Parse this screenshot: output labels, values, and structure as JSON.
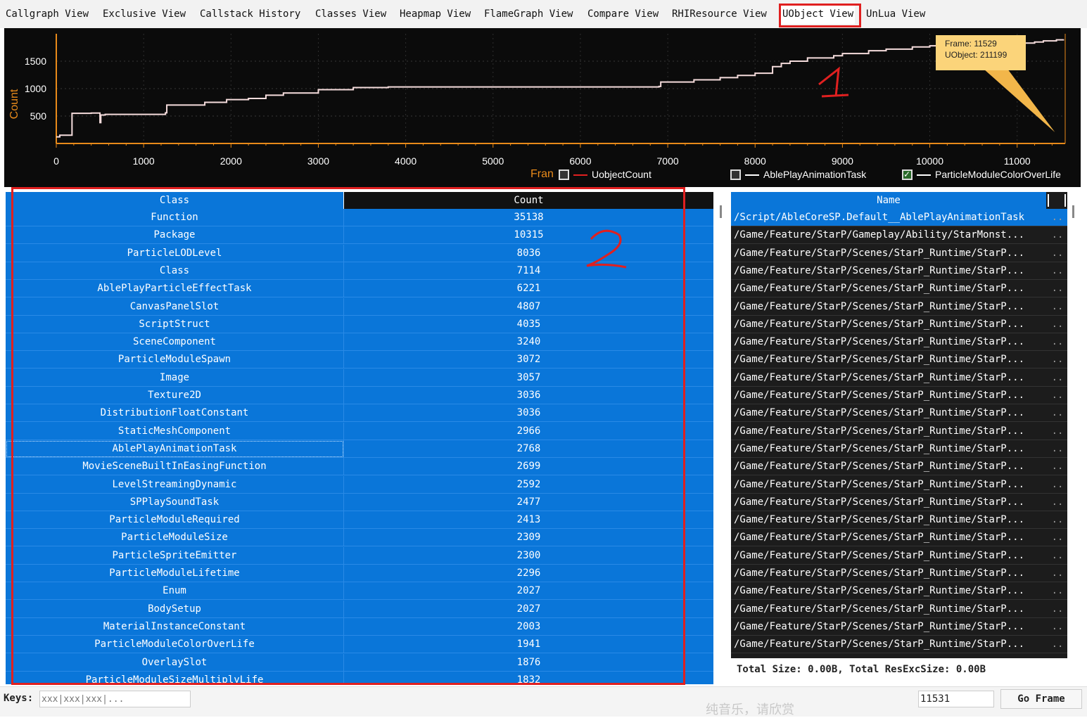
{
  "tabs": [
    {
      "label": "Callgraph View"
    },
    {
      "label": "Exclusive View"
    },
    {
      "label": "Callstack History"
    },
    {
      "label": "Classes View"
    },
    {
      "label": "Heapmap View"
    },
    {
      "label": "FlameGraph View"
    },
    {
      "label": "Compare View"
    },
    {
      "label": "RHIResource View"
    },
    {
      "label": "UObject View",
      "active": true
    },
    {
      "label": "UnLua View"
    }
  ],
  "annotations": {
    "one": "1",
    "two": "2"
  },
  "colors": {
    "selection_blue": "#0a76d9",
    "annotation_red": "#e02020",
    "chart_line": "#f5dcdc",
    "axis_orange": "#e88a1a",
    "tooltip_bg": "#fbd47a"
  },
  "chart_data": {
    "type": "line",
    "ylabel": "Count",
    "xlabel": "Fran",
    "xlim": [
      0,
      11550
    ],
    "ylim": [
      0,
      2000
    ],
    "yticks": [
      500,
      1000,
      1500
    ],
    "xticks": [
      0,
      1000,
      2000,
      3000,
      4000,
      5000,
      6000,
      7000,
      8000,
      9000,
      10000,
      11000
    ],
    "grid": true,
    "series": [
      {
        "name": "UobjectCount",
        "color": "#e02020",
        "checked": false,
        "x": [
          0,
          40,
          100,
          180,
          400,
          500,
          510,
          560,
          1250,
          1265,
          1700,
          1950,
          2200,
          2400,
          2600,
          3000,
          3400,
          3800,
          4500,
          5500,
          6500,
          6900,
          6920,
          7300,
          7600,
          7800,
          8000,
          8200,
          8300,
          8400,
          8600,
          8900,
          9000,
          9300,
          9500,
          9800,
          10000,
          10500,
          10800,
          11000,
          11200,
          11300,
          11450,
          11529
        ],
        "values": [
          120,
          150,
          150,
          550,
          555,
          380,
          520,
          530,
          560,
          700,
          750,
          800,
          820,
          880,
          920,
          980,
          1020,
          1030,
          1030,
          1030,
          1030,
          1040,
          1120,
          1160,
          1200,
          1240,
          1280,
          1400,
          1460,
          1500,
          1560,
          1600,
          1640,
          1690,
          1720,
          1760,
          1780,
          1790,
          1810,
          1830,
          1850,
          1870,
          1890,
          1900
        ]
      }
    ],
    "legend": [
      {
        "name": "UobjectCount",
        "checked": false,
        "color": "#e02020"
      },
      {
        "name": "AblePlayAnimationTask",
        "checked": false,
        "color": "#ffffff"
      },
      {
        "name": "ParticleModuleColorOverLife",
        "checked": true,
        "color": "#ffffff"
      }
    ],
    "tooltip": {
      "frame_text": "Frame: 11529",
      "uobject_text": "UObject: 211199"
    }
  },
  "class_table": {
    "headers": {
      "class": "Class",
      "count": "Count"
    },
    "rows": [
      {
        "class": "Function",
        "count": "35138"
      },
      {
        "class": "Package",
        "count": "10315"
      },
      {
        "class": "ParticleLODLevel",
        "count": "8036"
      },
      {
        "class": "Class",
        "count": "7114"
      },
      {
        "class": "AblePlayParticleEffectTask",
        "count": "6221"
      },
      {
        "class": "CanvasPanelSlot",
        "count": "4807"
      },
      {
        "class": "ScriptStruct",
        "count": "4035"
      },
      {
        "class": "SceneComponent",
        "count": "3240"
      },
      {
        "class": "ParticleModuleSpawn",
        "count": "3072"
      },
      {
        "class": "Image",
        "count": "3057"
      },
      {
        "class": "Texture2D",
        "count": "3036"
      },
      {
        "class": "DistributionFloatConstant",
        "count": "3036"
      },
      {
        "class": "StaticMeshComponent",
        "count": "2966"
      },
      {
        "class": "AblePlayAnimationTask",
        "count": "2768"
      },
      {
        "class": "MovieSceneBuiltInEasingFunction",
        "count": "2699"
      },
      {
        "class": "LevelStreamingDynamic",
        "count": "2592"
      },
      {
        "class": "SPPlaySoundTask",
        "count": "2477"
      },
      {
        "class": "ParticleModuleRequired",
        "count": "2413"
      },
      {
        "class": "ParticleModuleSize",
        "count": "2309"
      },
      {
        "class": "ParticleSpriteEmitter",
        "count": "2300"
      },
      {
        "class": "ParticleModuleLifetime",
        "count": "2296"
      },
      {
        "class": "Enum",
        "count": "2027"
      },
      {
        "class": "BodySetup",
        "count": "2027"
      },
      {
        "class": "MaterialInstanceConstant",
        "count": "2003"
      },
      {
        "class": "ParticleModuleColorOverLife",
        "count": "1941"
      },
      {
        "class": "OverlaySlot",
        "count": "1876"
      },
      {
        "class": "ParticleModuleSizeMultiplyLife",
        "count": "1832"
      }
    ]
  },
  "name_table": {
    "header": "Name",
    "rows": [
      "/Script/AbleCoreSP.Default__AblePlayAnimationTask",
      "/Game/Feature/StarP/Gameplay/Ability/StarMonst...",
      "/Game/Feature/StarP/Scenes/StarP_Runtime/StarP...",
      "/Game/Feature/StarP/Scenes/StarP_Runtime/StarP...",
      "/Game/Feature/StarP/Scenes/StarP_Runtime/StarP...",
      "/Game/Feature/StarP/Scenes/StarP_Runtime/StarP...",
      "/Game/Feature/StarP/Scenes/StarP_Runtime/StarP...",
      "/Game/Feature/StarP/Scenes/StarP_Runtime/StarP...",
      "/Game/Feature/StarP/Scenes/StarP_Runtime/StarP...",
      "/Game/Feature/StarP/Scenes/StarP_Runtime/StarP...",
      "/Game/Feature/StarP/Scenes/StarP_Runtime/StarP...",
      "/Game/Feature/StarP/Scenes/StarP_Runtime/StarP...",
      "/Game/Feature/StarP/Scenes/StarP_Runtime/StarP...",
      "/Game/Feature/StarP/Scenes/StarP_Runtime/StarP...",
      "/Game/Feature/StarP/Scenes/StarP_Runtime/StarP...",
      "/Game/Feature/StarP/Scenes/StarP_Runtime/StarP...",
      "/Game/Feature/StarP/Scenes/StarP_Runtime/StarP...",
      "/Game/Feature/StarP/Scenes/StarP_Runtime/StarP...",
      "/Game/Feature/StarP/Scenes/StarP_Runtime/StarP...",
      "/Game/Feature/StarP/Scenes/StarP_Runtime/StarP...",
      "/Game/Feature/StarP/Scenes/StarP_Runtime/StarP...",
      "/Game/Feature/StarP/Scenes/StarP_Runtime/StarP...",
      "/Game/Feature/StarP/Scenes/StarP_Runtime/StarP...",
      "/Game/Feature/StarP/Scenes/StarP_Runtime/StarP...",
      "/Game/Feature/StarP/Scenes/StarP_Runtime/StarP..."
    ],
    "dots": ".."
  },
  "totals": "Total Size: 0.00B, Total ResExcSize: 0.00B",
  "status": {
    "keys_label": "Keys:",
    "keys_placeholder": "xxx|xxx|xxx|...",
    "frame_value": "11531",
    "go_frame_label": "Go Frame",
    "watermark": "纯音乐，请欣赏"
  }
}
